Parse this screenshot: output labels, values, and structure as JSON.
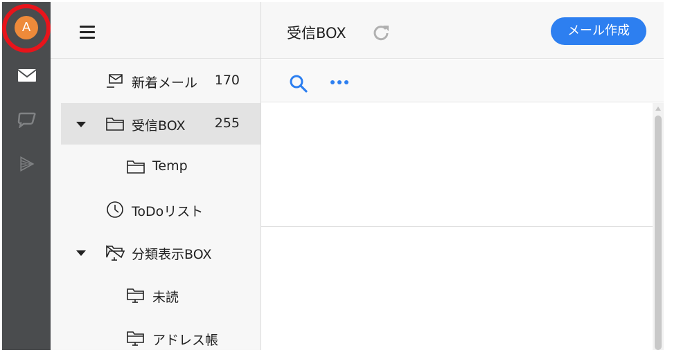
{
  "user": {
    "avatar_initial": "A",
    "avatar_color": "#ee8a3a"
  },
  "rail": {
    "icons": [
      "mail-icon",
      "chat-icon",
      "media-icon"
    ]
  },
  "folders": {
    "new_mail": {
      "label": "新着メール",
      "count": "170"
    },
    "inbox": {
      "label": "受信BOX",
      "count": "255"
    },
    "temp": {
      "label": "Temp"
    },
    "todo": {
      "label": "ToDoリスト"
    },
    "classified": {
      "label": "分類表示BOX"
    },
    "unread": {
      "label": "未読"
    },
    "address_book": {
      "label": "アドレス帳"
    }
  },
  "main": {
    "title": "受信BOX",
    "compose_label": "メール作成"
  },
  "colors": {
    "accent": "#2d7ff0",
    "rail": "#4a4c4e",
    "highlight_ring": "#e8141b"
  }
}
